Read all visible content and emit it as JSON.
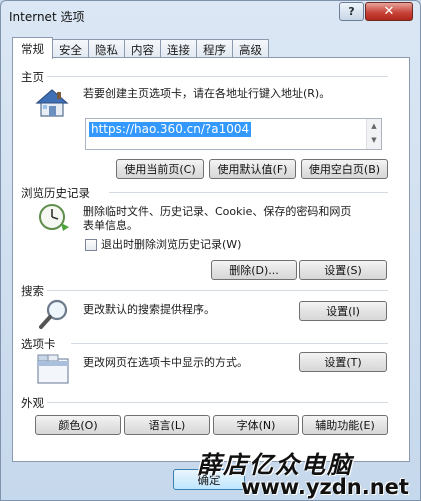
{
  "window": {
    "title": "Internet 选项",
    "help_label": "?",
    "close_label": "✕"
  },
  "tabs": [
    {
      "label": "常规",
      "active": true
    },
    {
      "label": "安全"
    },
    {
      "label": "隐私"
    },
    {
      "label": "内容"
    },
    {
      "label": "连接"
    },
    {
      "label": "程序"
    },
    {
      "label": "高级"
    }
  ],
  "homepage": {
    "section_label": "主页",
    "description": "若要创建主页选项卡，请在各地址行键入地址(R)。",
    "url_value": "https://hao.360.cn/?a1004",
    "btn_current": "使用当前页(C)",
    "btn_default": "使用默认值(F)",
    "btn_blank": "使用空白页(B)"
  },
  "history": {
    "section_label": "浏览历史记录",
    "description_line1": "删除临时文件、历史记录、Cookie、保存的密码和网页",
    "description_line2": "表单信息。",
    "checkbox_label": "退出时删除浏览历史记录(W)",
    "checkbox_checked": false,
    "btn_delete": "删除(D)...",
    "btn_settings": "设置(S)"
  },
  "search": {
    "section_label": "搜索",
    "description": "更改默认的搜索提供程序。",
    "btn_settings": "设置(I)"
  },
  "tabs_section": {
    "section_label": "选项卡",
    "description": "更改网页在选项卡中显示的方式。",
    "btn_settings": "设置(T)"
  },
  "appearance": {
    "section_label": "外观",
    "btn_colors": "颜色(O)",
    "btn_languages": "语言(L)",
    "btn_fonts": "字体(N)",
    "btn_accessibility": "辅助功能(E)"
  },
  "footer": {
    "btn_ok": "确定"
  },
  "watermark": {
    "line1": "薛店亿众电脑",
    "line2": "www.yzdn.net"
  },
  "colors": {
    "selection": "#3399ff",
    "close_button": "#c7453a",
    "frame": "#c9d9ea"
  }
}
